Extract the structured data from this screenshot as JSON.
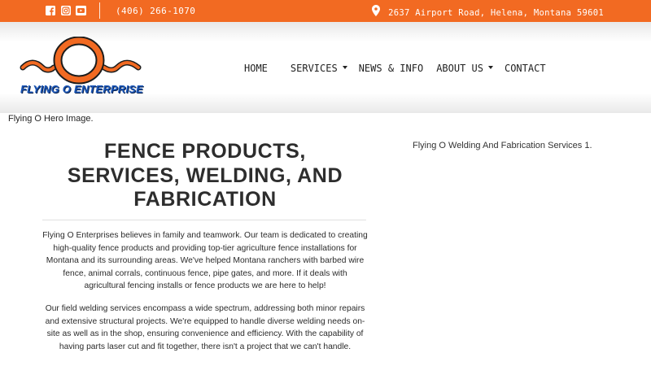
{
  "topbar": {
    "phone": "(406) 266-1070",
    "address": "2637 Airport Road, Helena, Montana 59601",
    "social_icons": [
      "facebook-icon",
      "instagram-icon",
      "youtube-icon"
    ],
    "background": "#f26a22"
  },
  "header": {
    "logo_text": "FLYING O ENTERPRISE",
    "logo_colors": {
      "ring": "#f26a22",
      "text": "#1a56b8"
    }
  },
  "nav": {
    "items": [
      {
        "label": "HOME",
        "dropdown": false
      },
      {
        "label": "SERVICES",
        "dropdown": true
      },
      {
        "label": "NEWS & INFO",
        "dropdown": false
      },
      {
        "label": "ABOUT US",
        "dropdown": true
      },
      {
        "label": "CONTACT",
        "dropdown": false
      }
    ]
  },
  "hero": {
    "alt_text": "Flying O Hero Image."
  },
  "main": {
    "title_lines": [
      "FENCE PRODUCTS,",
      "SERVICES, WELDING, AND",
      "FABRICATION"
    ],
    "paragraph1": "Flying O Enterprises believes in family and teamwork. Our team is dedicated to creating high-quality fence products and providing top-tier agriculture fence installations for Montana and its surrounding areas. We've helped Montana ranchers with barbed wire fence, animal corrals, continuous fence, pipe gates, and more. If it deals with agricultural fencing installs or fence products we are here to help!",
    "paragraph2": "Our field welding services encompass a wide spectrum, addressing both minor repairs and extensive structural projects. We're equipped to handle diverse welding needs on-site as well as in the shop, ensuring convenience and efficiency. With the capability of having parts laser cut and fit together, there isn't a project that we can't handle."
  },
  "side": {
    "image_alt": "Flying O Welding And Fabrication Services 1."
  }
}
